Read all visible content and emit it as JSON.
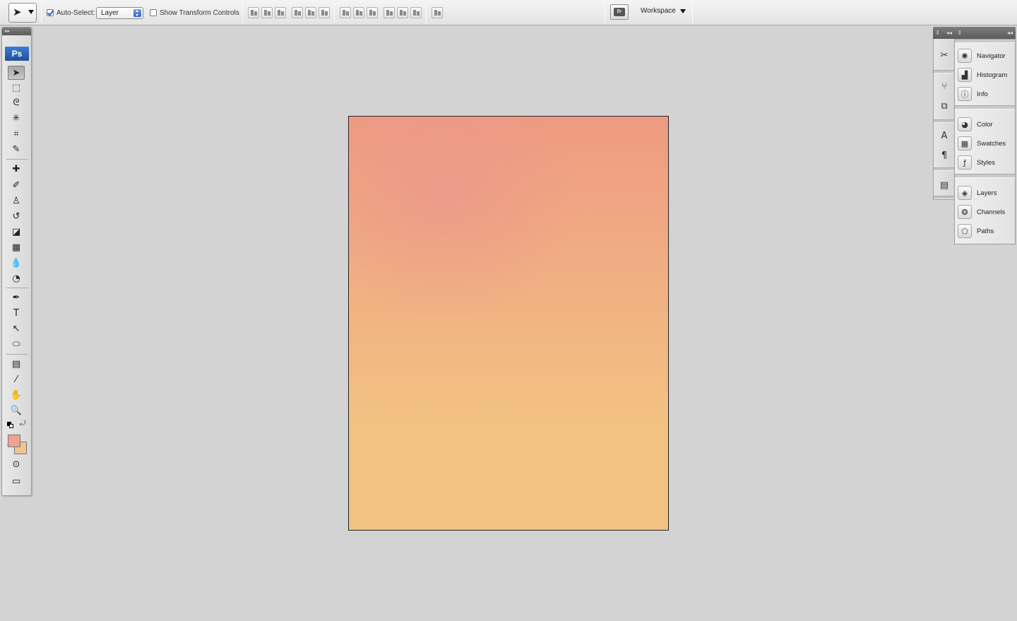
{
  "options_bar": {
    "auto_select_label": "Auto-Select:",
    "auto_select_checked": true,
    "auto_select_value": "Layer",
    "transform_controls_label": "Show Transform Controls",
    "transform_controls_checked": false,
    "workspace_label": "Workspace",
    "bridge_icon_text": "Br"
  },
  "toolbox": {
    "logo": "Ps",
    "grip": "▸▸",
    "tools": [
      {
        "name": "move-tool-icon",
        "glyph": "➤"
      },
      {
        "name": "marquee-tool-icon",
        "glyph": "⬚"
      },
      {
        "name": "lasso-tool-icon",
        "glyph": "ᘓ"
      },
      {
        "name": "magic-wand-tool-icon",
        "glyph": "✳"
      },
      {
        "name": "crop-tool-icon",
        "glyph": "⌗"
      },
      {
        "name": "slice-tool-icon",
        "glyph": "✎"
      },
      {
        "name": "healing-brush-tool-icon",
        "glyph": "✚"
      },
      {
        "name": "brush-tool-icon",
        "glyph": "✐"
      },
      {
        "name": "clone-stamp-tool-icon",
        "glyph": "♙"
      },
      {
        "name": "history-brush-tool-icon",
        "glyph": "↺"
      },
      {
        "name": "eraser-tool-icon",
        "glyph": "◪"
      },
      {
        "name": "gradient-tool-icon",
        "glyph": "▦"
      },
      {
        "name": "blur-tool-icon",
        "glyph": "💧"
      },
      {
        "name": "dodge-tool-icon",
        "glyph": "◔"
      },
      {
        "name": "pen-tool-icon",
        "glyph": "✒"
      },
      {
        "name": "type-tool-icon",
        "glyph": "T"
      },
      {
        "name": "path-selection-tool-icon",
        "glyph": "↖"
      },
      {
        "name": "ellipse-tool-icon",
        "glyph": "⬭"
      },
      {
        "name": "notes-tool-icon",
        "glyph": "▤"
      },
      {
        "name": "eyedropper-tool-icon",
        "glyph": "⁄"
      },
      {
        "name": "hand-tool-icon",
        "glyph": "✋"
      },
      {
        "name": "zoom-tool-icon",
        "glyph": "🔍"
      }
    ],
    "foreground_color": "#f0a28c",
    "background_color": "#f2c48e"
  },
  "icon_dock": [
    {
      "name": "tool-presets-icon",
      "glyph": "✂"
    },
    {
      "name": "brushes-icon",
      "glyph": "⑂"
    },
    {
      "name": "clone-source-icon",
      "glyph": "⧉"
    },
    {
      "name": "character-icon",
      "glyph": "A"
    },
    {
      "name": "paragraph-icon",
      "glyph": "¶"
    },
    {
      "name": "layer-comps-icon",
      "glyph": "▤"
    }
  ],
  "panels": [
    {
      "name": "navigator",
      "label": "Navigator",
      "glyph": "✺"
    },
    {
      "name": "histogram",
      "label": "Histogram",
      "glyph": "▟"
    },
    {
      "name": "info",
      "label": "Info",
      "glyph": "ⓘ"
    },
    {
      "name": "color",
      "label": "Color",
      "glyph": "◕"
    },
    {
      "name": "swatches",
      "label": "Swatches",
      "glyph": "▦"
    },
    {
      "name": "styles",
      "label": "Styles",
      "glyph": "ƒ"
    },
    {
      "name": "layers",
      "label": "Layers",
      "glyph": "◈"
    },
    {
      "name": "channels",
      "label": "Channels",
      "glyph": "❂"
    },
    {
      "name": "paths",
      "label": "Paths",
      "glyph": "⬠"
    }
  ],
  "document": {
    "gradient_top_color": "#ef9a82",
    "gradient_bottom_color": "#f2c282"
  }
}
